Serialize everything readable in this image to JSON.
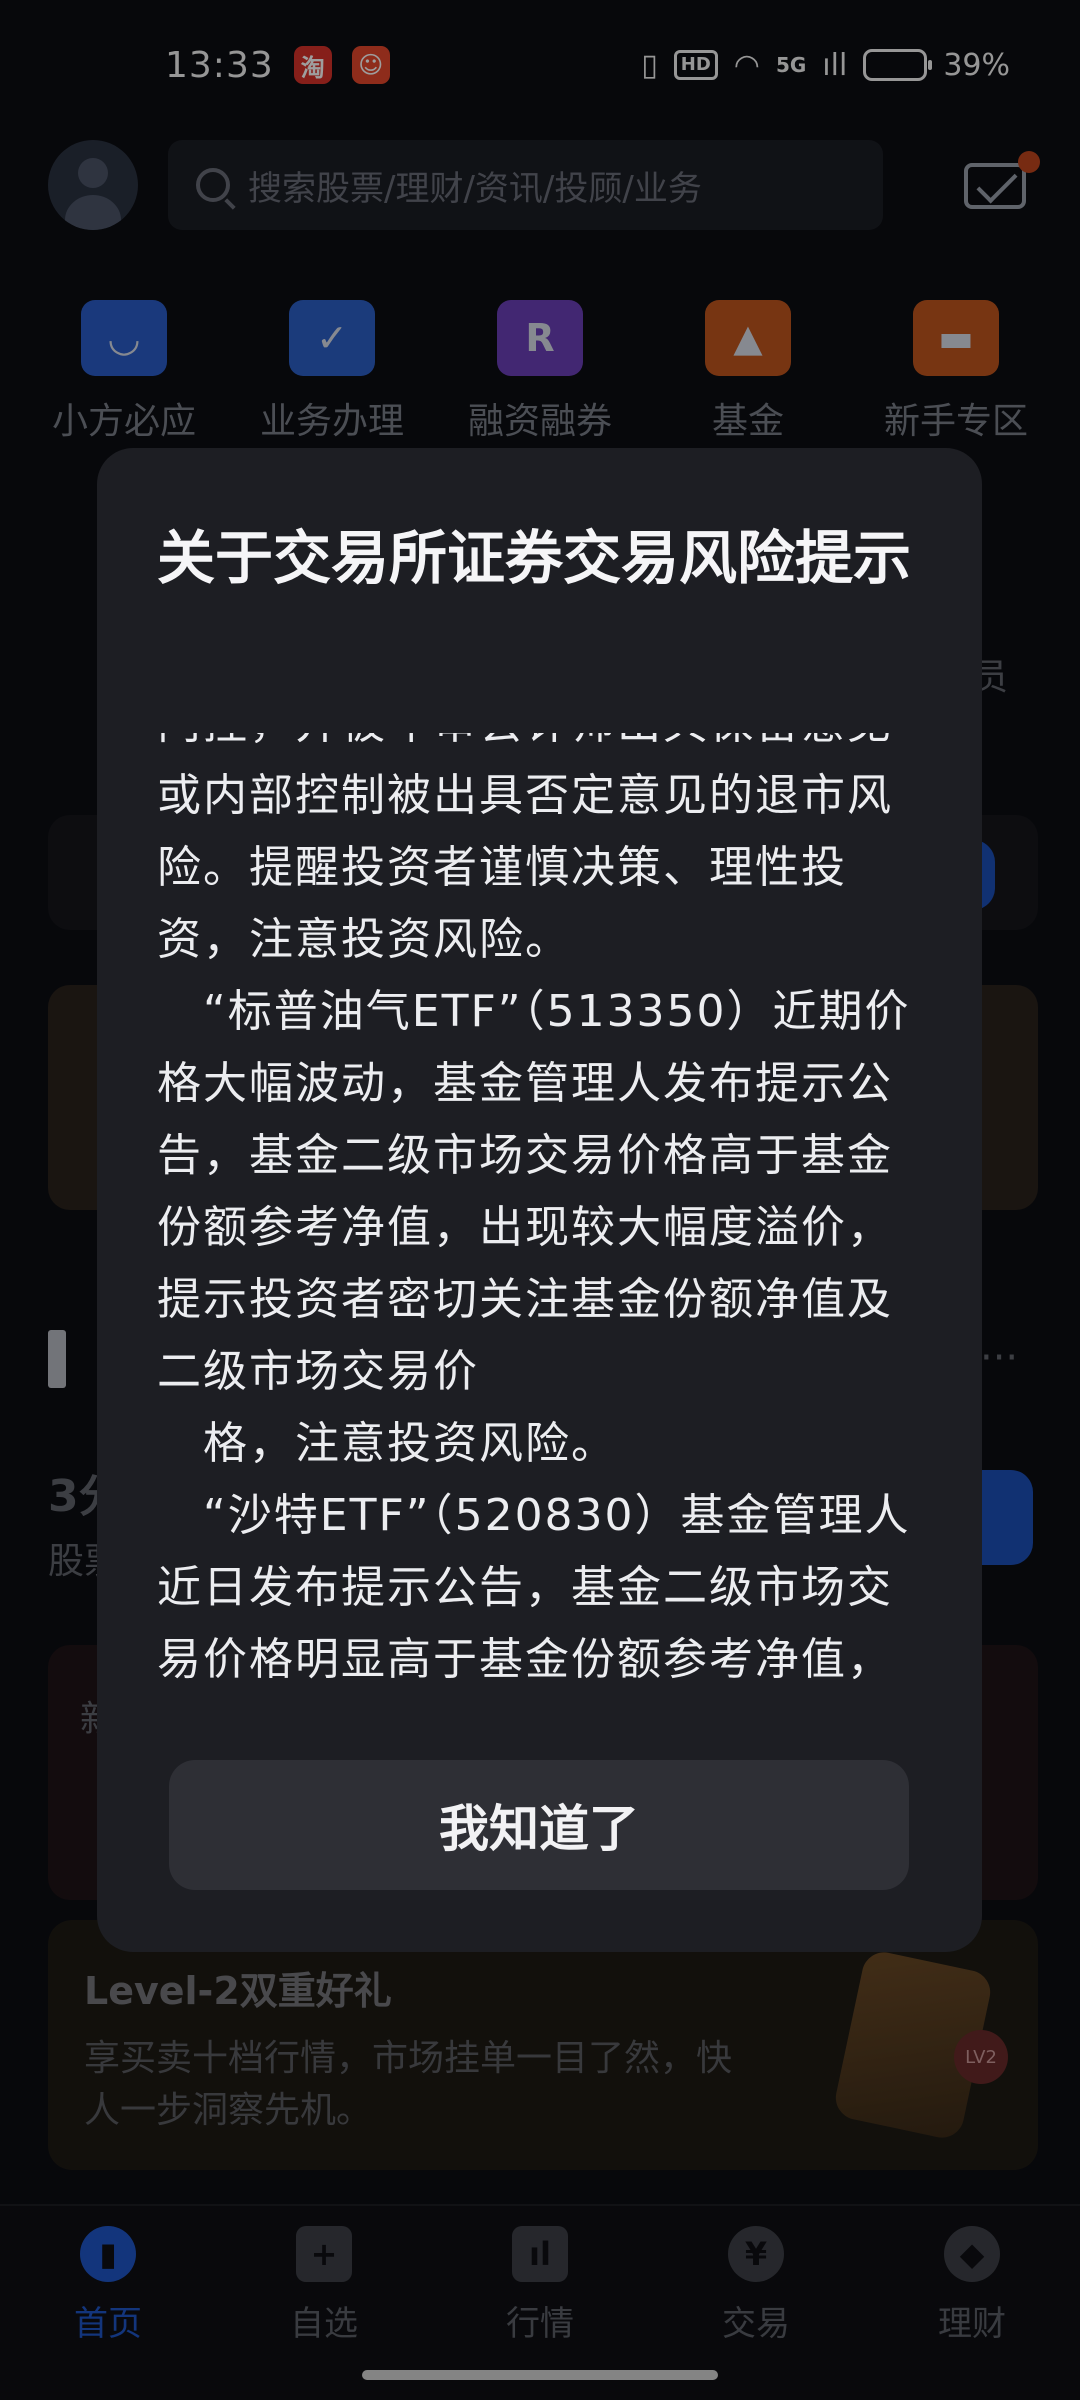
{
  "status_bar": {
    "time": "13:33",
    "app_badges": [
      {
        "icon": "taobao-icon",
        "glyph": "淘",
        "color": "#d9322b"
      },
      {
        "icon": "mascot-app-icon",
        "glyph": "☺",
        "color": "#e5472c"
      }
    ],
    "network": "5G",
    "hd": "HD",
    "battery_percent": "39%",
    "battery_level": 0.39
  },
  "header": {
    "search_placeholder": "搜索股票/理财/资讯/投顾/业务"
  },
  "quick_services": [
    {
      "label": "小方必应",
      "icon": "chat-bubble-icon",
      "color": "#2a5cc9",
      "glyph": "◡"
    },
    {
      "label": "业务办理",
      "icon": "folder-check-icon",
      "color": "#2d5fc7",
      "glyph": "✓"
    },
    {
      "label": "融资融券",
      "icon": "margin-r-icon",
      "color": "#6b3fb8",
      "glyph": "R"
    },
    {
      "label": "基金",
      "icon": "gold-bars-icon",
      "color": "#c0561e",
      "glyph": "▲"
    },
    {
      "label": "新手专区",
      "icon": "gift-bag-icon",
      "color": "#c0561e",
      "glyph": "▬"
    }
  ],
  "background": {
    "member_text": "员",
    "section_more": "···",
    "line1": "3分",
    "line2": "股票",
    "new_char": "新",
    "level2": {
      "title": "Level-2双重好礼",
      "desc": "享买卖十档行情，市场挂单一目了然，快人一步洞察先机。",
      "badge": "LV2"
    }
  },
  "modal": {
    "title": "关于交易所证券交易风险提示",
    "paragraphs": [
      "内控，并被年审会计师出具保留意见或内部控制被出具否定意见的退市风险。提醒投资者谨慎决策、理性投资，注意投资风险。",
      "　“标普油气ETF”（513350）近期价格大幅波动，基金管理人发布提示公告，基金二级市场交易价格高于基金份额参考净值，出现较大幅度溢价，提示投资者密切关注基金份额净值及二级市场交易价",
      "　格，注意投资风险。",
      "　“沙特ETF”（520830）基金管理人近日发布提示公告，基金二级市场交易价格明显高于基金份额参考净值，出现较大幅度溢价。"
    ],
    "confirm_label": "我知道了"
  },
  "bottom_nav": [
    {
      "label": "首页",
      "icon": "home-icon",
      "glyph": "▮",
      "active": true
    },
    {
      "label": "自选",
      "icon": "add-watchlist-icon",
      "glyph": "+",
      "active": false
    },
    {
      "label": "行情",
      "icon": "market-chart-icon",
      "glyph": "ıl",
      "active": false
    },
    {
      "label": "交易",
      "icon": "yen-trade-icon",
      "glyph": "¥",
      "active": false
    },
    {
      "label": "理财",
      "icon": "wealth-diamond-icon",
      "glyph": "◆",
      "active": false
    }
  ]
}
